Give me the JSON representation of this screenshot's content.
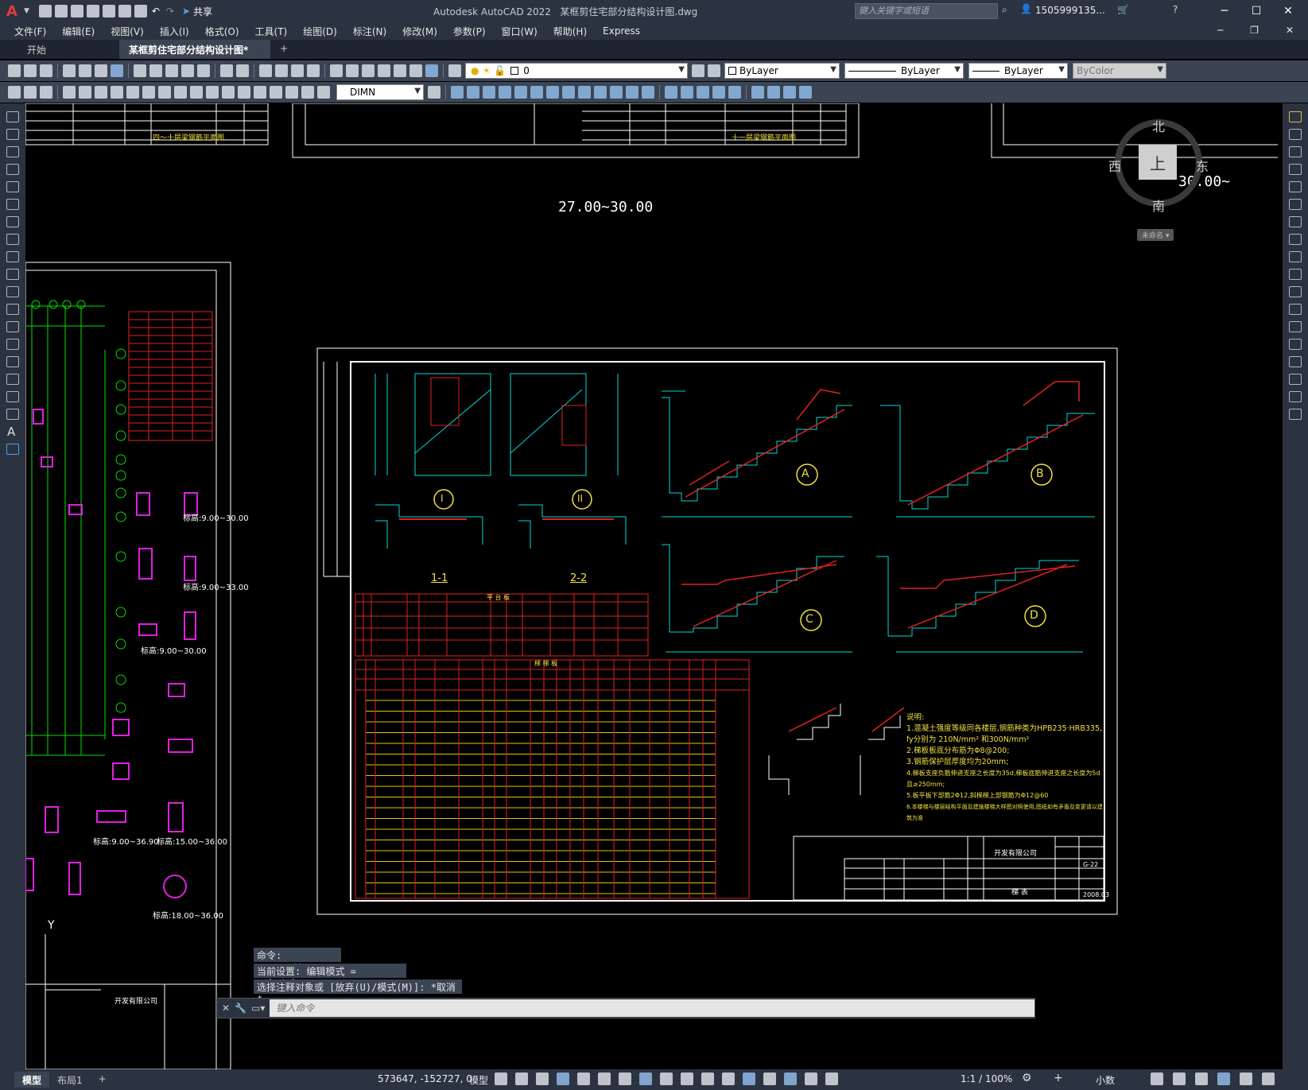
{
  "app": {
    "title": "Autodesk AutoCAD 2022",
    "document": "某框剪住宅部分结构设计图.dwg",
    "share": "共享",
    "search_placeholder": "键入关键字或短语",
    "user": "1505999135...",
    "logo": "A"
  },
  "menu": [
    "文件(F)",
    "编辑(E)",
    "视图(V)",
    "插入(I)",
    "格式(O)",
    "工具(T)",
    "绘图(D)",
    "标注(N)",
    "修改(M)",
    "参数(P)",
    "窗口(W)",
    "帮助(H)",
    "Express"
  ],
  "tabs": {
    "start": "开始",
    "drawing": "某框剪住宅部分结构设计图*",
    "add": "+"
  },
  "toolbar": {
    "layer_value": "0",
    "color": "ByLayer",
    "linetype": "ByLayer",
    "lineweight": "ByLayer",
    "plotstyle": "ByColor",
    "dimstyle": "DIMN"
  },
  "viewcube": {
    "north": "北",
    "south": "南",
    "east": "东",
    "west": "西",
    "top": "上",
    "wcs": "未命名"
  },
  "drawing": {
    "elev_main": "27.00~30.00",
    "elev_right": "30.00~",
    "stair_labels": [
      "A",
      "B",
      "C",
      "D"
    ],
    "detail_labels": [
      "I",
      "II"
    ],
    "sections": [
      "1-1",
      "2-2"
    ],
    "table_platform_title": "平 台 板",
    "table_stair_title": "梯 梯 板",
    "notes_title": "说明:",
    "notes": [
      "1.混凝土强度等级同各楼层,钢筋种类为HPB235·HRB335,",
      "fy分别为 210N/mm² 和300N/mm²",
      "2.梯板板底分布筋为Φ8@200;",
      "3.钢筋保护层厚度均为20mm;",
      "4.梯板支座负筋伸进支座之长度为35d,梯板底筋伸进支座之长度为5d且≥250mm;",
      "5.板平板下部筋2Φ12,斜梯梯上部钢筋为Φ12@60",
      "6.本楼梯与楼层结构平面及建施楼梯大样图对照使用,图纸如有矛盾及变更请以建筑为准"
    ],
    "company": "开发有限公司",
    "sheet_title": "梯 表",
    "drawing_no": "G-22",
    "date": "2008.03",
    "left_sheet_title": "四～十层梁钢筋平面图",
    "mid_sheet_title": "十一层梁钢筋平面图",
    "left_marks": [
      "标高:9.00~30.00",
      "标高:9.00~33.00",
      "标高:9.00~30.00",
      "标高:9.00~36.90",
      "标高:15.00~36.00",
      "标高:18.00~36.00"
    ],
    "ucs_y": "Y"
  },
  "command": {
    "line1": "命令: _textedit",
    "line2": "当前设置: 编辑模式 = Multiple",
    "line3": "选择注释对象或 [放弃(U)/模式(M)]: *取消*",
    "placeholder": "键入命令"
  },
  "status": {
    "model_tab": "模型",
    "layout_tab": "布局1",
    "add": "+",
    "coords": "573647, -152727, 0",
    "model": "模型",
    "scale": "1:1 / 100%",
    "units": "小数"
  }
}
